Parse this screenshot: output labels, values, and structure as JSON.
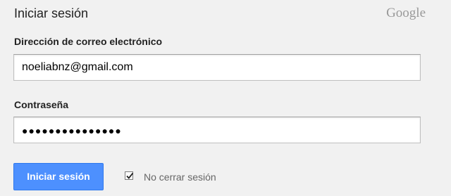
{
  "header": {
    "title": "Iniciar sesión",
    "brand": "Google"
  },
  "form": {
    "email": {
      "label": "Dirección de correo electrónico",
      "value": "noeliabnz@gmail.com"
    },
    "password": {
      "label": "Contraseña",
      "masked_value": "●●●●●●●●●●●●●●●"
    },
    "submit_label": "Iniciar sesión",
    "stay_signed_in": {
      "label": "No cerrar sesión",
      "checked": true
    }
  },
  "colors": {
    "background": "#f1f1f1",
    "button": "#4d90fe",
    "button_border": "#3079ed"
  }
}
